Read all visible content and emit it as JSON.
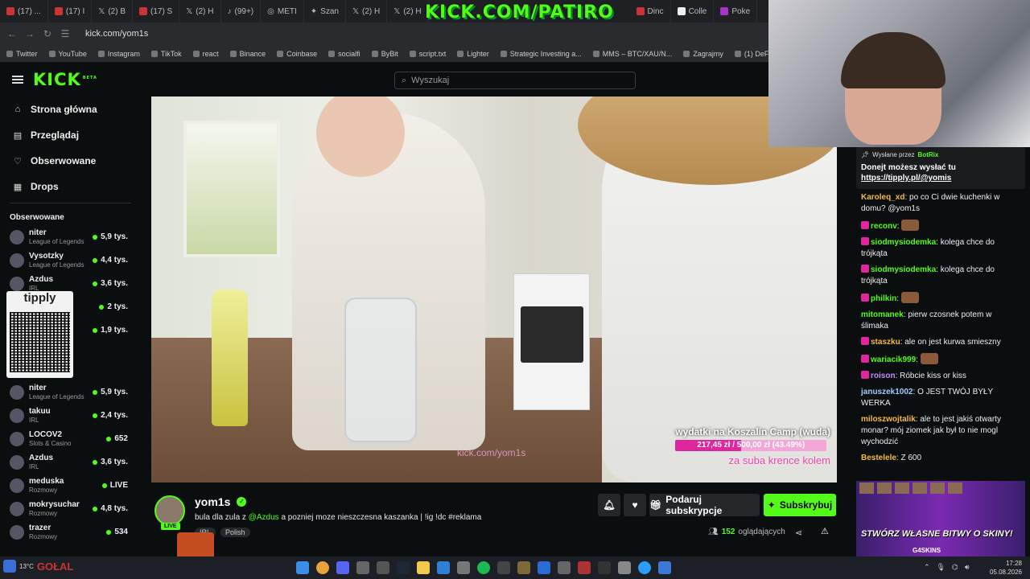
{
  "browser": {
    "tabs": [
      {
        "label": "(17) ..."
      },
      {
        "label": "(17) I"
      },
      {
        "label": "(2) B"
      },
      {
        "label": "(17) S"
      },
      {
        "label": "(2) H"
      },
      {
        "label": "(99+)"
      },
      {
        "label": "METI"
      },
      {
        "label": "Szan"
      },
      {
        "label": "(2) H"
      },
      {
        "label": "(2) H"
      }
    ],
    "tabs_right": [
      {
        "label": "Dinc"
      },
      {
        "label": "Colle"
      },
      {
        "label": "Poke"
      }
    ],
    "overlay_title": "KICK.COM/PATIRO",
    "url": "kick.com/yom1s",
    "bookmarks": [
      "Twitter",
      "YouTube",
      "Instagram",
      "TikTok",
      "react",
      "Binance",
      "Coinbase",
      "socialfi",
      "ByBit",
      "script.txt",
      "Lighter",
      "Strategic Investing a...",
      "MMS – BTC/XAU/N...",
      "Zagrajmy",
      "(1) DeFi Warhol on..."
    ]
  },
  "header": {
    "logo": "KICK",
    "logo_tag": "BETA",
    "search_placeholder": "Wyszukaj"
  },
  "sidebar": {
    "nav": [
      {
        "label": "Strona główna",
        "icon": "home-icon"
      },
      {
        "label": "Przeglądaj",
        "icon": "browse-icon"
      },
      {
        "label": "Obserwowane",
        "icon": "heart-icon"
      },
      {
        "label": "Drops",
        "icon": "drops-icon"
      }
    ],
    "section_title": "Obserwowane",
    "channels_top": [
      {
        "name": "niter",
        "category": "League of Legends",
        "viewers": "5,9 tys."
      },
      {
        "name": "Vysotzky",
        "category": "League of Legends",
        "viewers": "4,4 tys."
      },
      {
        "name": "Azdus",
        "category": "IRL",
        "viewers": "3,6 tys."
      }
    ],
    "channels_hidden": [
      {
        "viewers": "2 tys."
      },
      {
        "viewers": "1,9 tys."
      }
    ],
    "qr_title": "tipply",
    "channels_bottom": [
      {
        "name": "niter",
        "category": "League of Legends",
        "viewers": "5,9 tys."
      },
      {
        "name": "takuu",
        "category": "IRL",
        "viewers": "2,4 tys."
      },
      {
        "name": "LOCOV2",
        "category": "Slots & Casino",
        "viewers": "652"
      },
      {
        "name": "Azdus",
        "category": "IRL",
        "viewers": "3,6 tys."
      },
      {
        "name": "meduska",
        "category": "Rozmowy",
        "viewers": "LIVE"
      },
      {
        "name": "mokrysuchar",
        "category": "Rozmowy",
        "viewers": "4,8 tys."
      },
      {
        "name": "trazer",
        "category": "Rozmowy",
        "viewers": "534"
      }
    ]
  },
  "video": {
    "goal_title": "wydatki na Koszalin Camp (wuda)",
    "goal_amount": "217,45 zł / 500,00 zł (43.49%)",
    "goal_fraction": 0.4349,
    "goal_sub": "za suba krence kolem",
    "watermark": "kick.com/yom1s"
  },
  "stream": {
    "live_badge": "LIVE",
    "streamer": "yom1s",
    "title_prefix": "bula dla zula z ",
    "title_mention": "@Azdus",
    "title_suffix": " a pozniej moze nieszczesna kaszanka | !ig !dc #reklama",
    "tag_category": "IRL",
    "tag_lang": "Polish",
    "gift_label": "Podaruj subskrypcje",
    "subscribe_label": "Subskrybuj",
    "viewers_count": "152",
    "viewers_label": "oglądających"
  },
  "pinned": {
    "sent_by": "Wysłane przez",
    "sender": "BotRix",
    "message": "Donejt możesz wysłać tu",
    "link": "https://tipply.pl/@yomis"
  },
  "chat": [
    {
      "user": "Karolеq_xd",
      "color": "#f5b942",
      "text": "po co Ci dwie kuchenki w domu? @yom1s",
      "badge": false
    },
    {
      "user": "reconv",
      "color": "#53fc18",
      "text": "",
      "badge": true,
      "emote": true
    },
    {
      "user": "siodmysiodemka",
      "color": "#53fc18",
      "text": "kolega chce do trójkąta",
      "badge": true
    },
    {
      "user": "siodmysiodemka",
      "color": "#53fc18",
      "text": "kolega chce do trójkąta",
      "badge": true
    },
    {
      "user": "philkin",
      "color": "#53fc18",
      "text": "",
      "badge": true,
      "emote": true
    },
    {
      "user": "mitomanek",
      "color": "#53fc18",
      "text": "pierw czosnek potem w ślimaka",
      "badge": false
    },
    {
      "user": "staszku",
      "color": "#f5b942",
      "text": "ale on jest kurwa smieszny",
      "badge": true
    },
    {
      "user": "wariacik999",
      "color": "#53fc18",
      "text": "",
      "badge": true,
      "emote": true
    },
    {
      "user": "roison",
      "color": "#c58cff",
      "text": "Róbcie kiss or kiss",
      "badge": true
    },
    {
      "user": "januszek1002",
      "color": "#9ecbff",
      "text": "O JEST TWÓJ BYŁY WERKA",
      "badge": false
    },
    {
      "user": "miloszwojtalik",
      "color": "#f5b942",
      "text": "ale to jest jakiś otwarty monar? mój ziomek jak był to nie mogl wychodzić",
      "badge": false
    },
    {
      "user": "Bestelele",
      "color": "#f5b942",
      "text": "Z 600",
      "badge": false
    }
  ],
  "ad": {
    "headline": "STWÓRZ WŁASNE BITWY O SKINY!",
    "brand": "G4SKINS"
  },
  "taskbar": {
    "weather": "13°C",
    "label": "GOŁAL",
    "time": "17:28",
    "date": "05.08.2026"
  },
  "colors": {
    "accent": "#53fc18",
    "goal_fill": "#e0269e"
  }
}
